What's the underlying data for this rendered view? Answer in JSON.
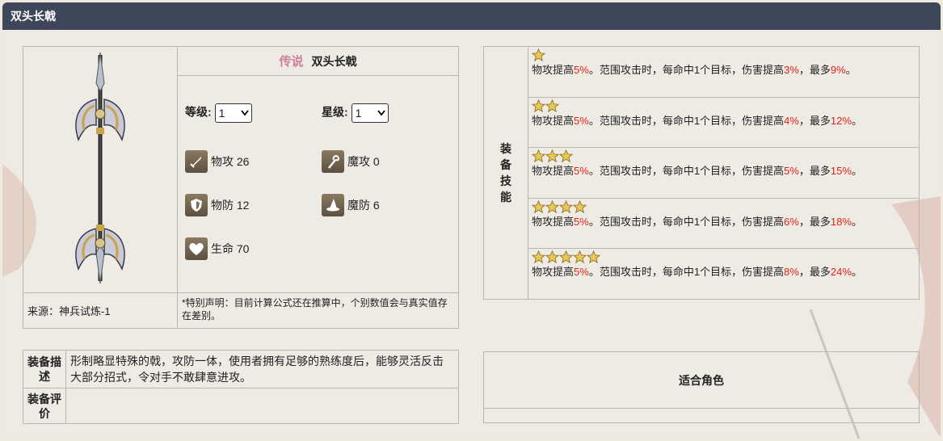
{
  "window_title": "双头长戟",
  "item": {
    "rarity_label": "传说",
    "name": "双头长戟",
    "level_label": "等级:",
    "level_value": "1",
    "star_label": "星级:",
    "star_value": "1",
    "stats": {
      "patk": "物攻 26",
      "matk": "魔攻 0",
      "pdef": "物防 12",
      "mdef": "魔防 6",
      "hp": "生命 70"
    },
    "source": "来源：神兵试炼-1",
    "note_line1": "*特别声明：目前计算公式还在推算中，个别数值会与真实值存",
    "note_line2": "在差别。"
  },
  "skill": {
    "header_chars": [
      "装",
      "备",
      "技",
      "能"
    ],
    "rows": [
      {
        "stars": 1,
        "p1": "物攻提高",
        "v1": "5%",
        "p2": "。范围攻击时，每命中1个目标，伤害提高",
        "v2": "3%",
        "p3": "，最多",
        "v3": "9%",
        "p4": "。"
      },
      {
        "stars": 2,
        "p1": "物攻提高",
        "v1": "5%",
        "p2": "。范围攻击时，每命中1个目标，伤害提高",
        "v2": "4%",
        "p3": "，最多",
        "v3": "12%",
        "p4": "。"
      },
      {
        "stars": 3,
        "p1": "物攻提高",
        "v1": "5%",
        "p2": "。范围攻击时，每命中1个目标，伤害提高",
        "v2": "5%",
        "p3": "，最多",
        "v3": "15%",
        "p4": "。"
      },
      {
        "stars": 4,
        "p1": "物攻提高",
        "v1": "5%",
        "p2": "。范围攻击时，每命中1个目标，伤害提高",
        "v2": "6%",
        "p3": "，最多",
        "v3": "18%",
        "p4": "。"
      },
      {
        "stars": 5,
        "p1": "物攻提高",
        "v1": "5%",
        "p2": "。范围攻击时，每命中1个目标，伤害提高",
        "v2": "8%",
        "p3": "，最多",
        "v3": "24%",
        "p4": "。"
      }
    ]
  },
  "description": {
    "label_line1": "装备描",
    "label_line2": "述",
    "text": "形制略显特殊的戟，攻防一体，使用者拥有足够的熟练度后，能够灵活反击大部分招式，令对手不敢肆意进攻。",
    "eval_label_line1": "装备评",
    "eval_label_line2": "价",
    "eval_text": ""
  },
  "roles": {
    "title": "适合角色"
  },
  "colors": {
    "titlebar": "#3e4659",
    "highlight_red": "#e2231a",
    "rarity": "#c8879e",
    "star": "#e8c65a"
  }
}
